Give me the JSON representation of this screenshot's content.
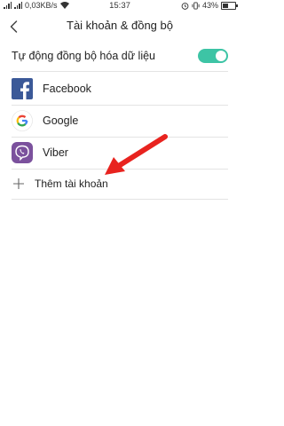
{
  "status_bar": {
    "network_speed": "0,03KB/s",
    "time": "15:37",
    "battery": "43%",
    "battery_level": 0.43
  },
  "header": {
    "title": "Tài khoản & đồng bộ",
    "back_icon": "chevron-left-icon"
  },
  "sync": {
    "label": "Tự động đồng bộ hóa dữ liệu",
    "enabled": true,
    "accent_color": "#3dc4a5"
  },
  "accounts": [
    {
      "label": "Facebook",
      "icon": "facebook-icon",
      "color": "#3b5998"
    },
    {
      "label": "Google",
      "icon": "google-icon",
      "color": "#4285f4"
    },
    {
      "label": "Viber",
      "icon": "viber-icon",
      "color": "#7b519d"
    }
  ],
  "add_account": {
    "label": "Thêm tài khoản",
    "icon": "plus-icon"
  },
  "annotation": {
    "icon": "red-arrow-icon",
    "color": "#e8231f"
  }
}
